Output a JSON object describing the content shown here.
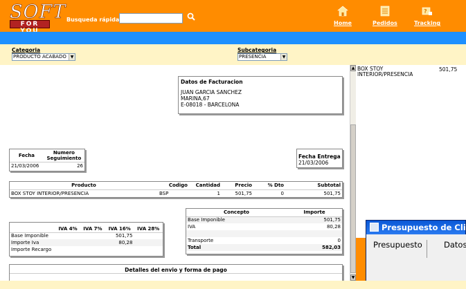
{
  "header": {
    "logo_text": "SOFT",
    "logo_subtext": "FOR YOU",
    "search_label": "Busqueda rápida",
    "search_value": "",
    "nav": [
      {
        "label": "Home",
        "icon": "home-icon"
      },
      {
        "label": "Pedidos",
        "icon": "orders-icon"
      },
      {
        "label": "Tracking",
        "icon": "tracking-icon"
      }
    ],
    "brand_orange": "#ff8c00",
    "brand_blue": "#1e90ff"
  },
  "filters": {
    "categoria_label": "Categoria",
    "categoria_value": "PRODUCTO ACABADO",
    "subcategoria_label": "Subcategoria",
    "subcategoria_value": "PRESENCIA"
  },
  "billing": {
    "title": "Datos de Facturacion",
    "name": "JUAN GARCIA SANCHEZ",
    "street": "MARINA,67",
    "city": "E-08018 - BARCELONA"
  },
  "order_info": {
    "fecha_label": "Fecha",
    "numero_label_1": "Numero",
    "numero_label_2": "Seguimiento",
    "fecha_value": "21/03/2006",
    "numero_value": "26"
  },
  "delivery": {
    "label": "Fecha Entrega",
    "value": "21/03/2006"
  },
  "products": {
    "headers": [
      "Producto",
      "Codigo",
      "Cantidad",
      "Precio",
      "% Dto",
      "Subtotal"
    ],
    "rows": [
      [
        "BOX STOY INTERIOR/PRESENCIA",
        "BSP",
        "1",
        "501,75",
        "0",
        "501,75"
      ]
    ]
  },
  "tax": {
    "headers": [
      "IVA 4%",
      "IVA 7%",
      "IVA 16%",
      "IVA 28%"
    ],
    "rows": [
      {
        "label": "Base Imponible",
        "iva16": "501,75"
      },
      {
        "label": "Importe Iva",
        "iva16": "80,28"
      },
      {
        "label": "Importe Recargo",
        "iva16": ""
      }
    ]
  },
  "concepts": {
    "headers": [
      "Concepto",
      "Importe"
    ],
    "rows": [
      {
        "label": "Base Imponible",
        "value": "501,75"
      },
      {
        "label": "IVA",
        "value": "80,28"
      },
      {
        "label": "",
        "value": ""
      },
      {
        "label": "Transporte",
        "value": "0"
      },
      {
        "label": "Total",
        "value": "582,03"
      }
    ]
  },
  "shipping": {
    "title": "Detalles del envio y forma de pago"
  },
  "side_panel": {
    "item_line1": "BOX STOY",
    "item_line2": "INTERIOR/PRESENCIA",
    "item_value": "501,75"
  },
  "dialog": {
    "title": "Presupuesto de Cli",
    "tabs": [
      "Presupuesto",
      "Datos"
    ]
  }
}
